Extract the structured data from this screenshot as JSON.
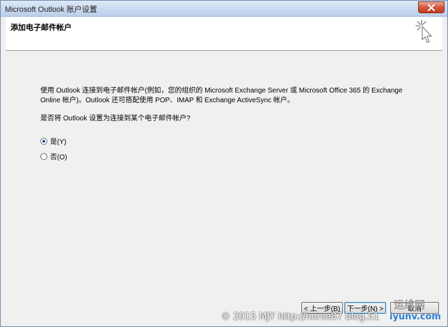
{
  "window": {
    "title": "Microsoft Outlook 账户设置"
  },
  "header": {
    "title": "添加电子邮件帐户"
  },
  "content": {
    "description": "使用 Outlook 连接到电子邮件帐户(例如，您的组织的 Microsoft Exchange Server 或 Microsoft Office 365 的 Exchange Online 帐户)。Outlook 还可搭配使用 POP、IMAP 和 Exchange ActiveSync 帐户。",
    "question": "是否将 Outlook 设置为连接到某个电子邮件帐户?",
    "options": [
      {
        "label": "是(Y)",
        "selected": true
      },
      {
        "label": "否(O)",
        "selected": false
      }
    ]
  },
  "buttons": {
    "back": "< 上一步(B)",
    "next": "下一步(N) >",
    "cancel": "取消"
  },
  "watermark": {
    "text": "© 2015 MJY http://horse87 blog.51",
    "logo": "运维网",
    "site": "iyunv.com"
  },
  "colors": {
    "titlebar": "#c9d9ee",
    "close_button": "#d2573e",
    "selected_radio": "#1a4fa8"
  }
}
